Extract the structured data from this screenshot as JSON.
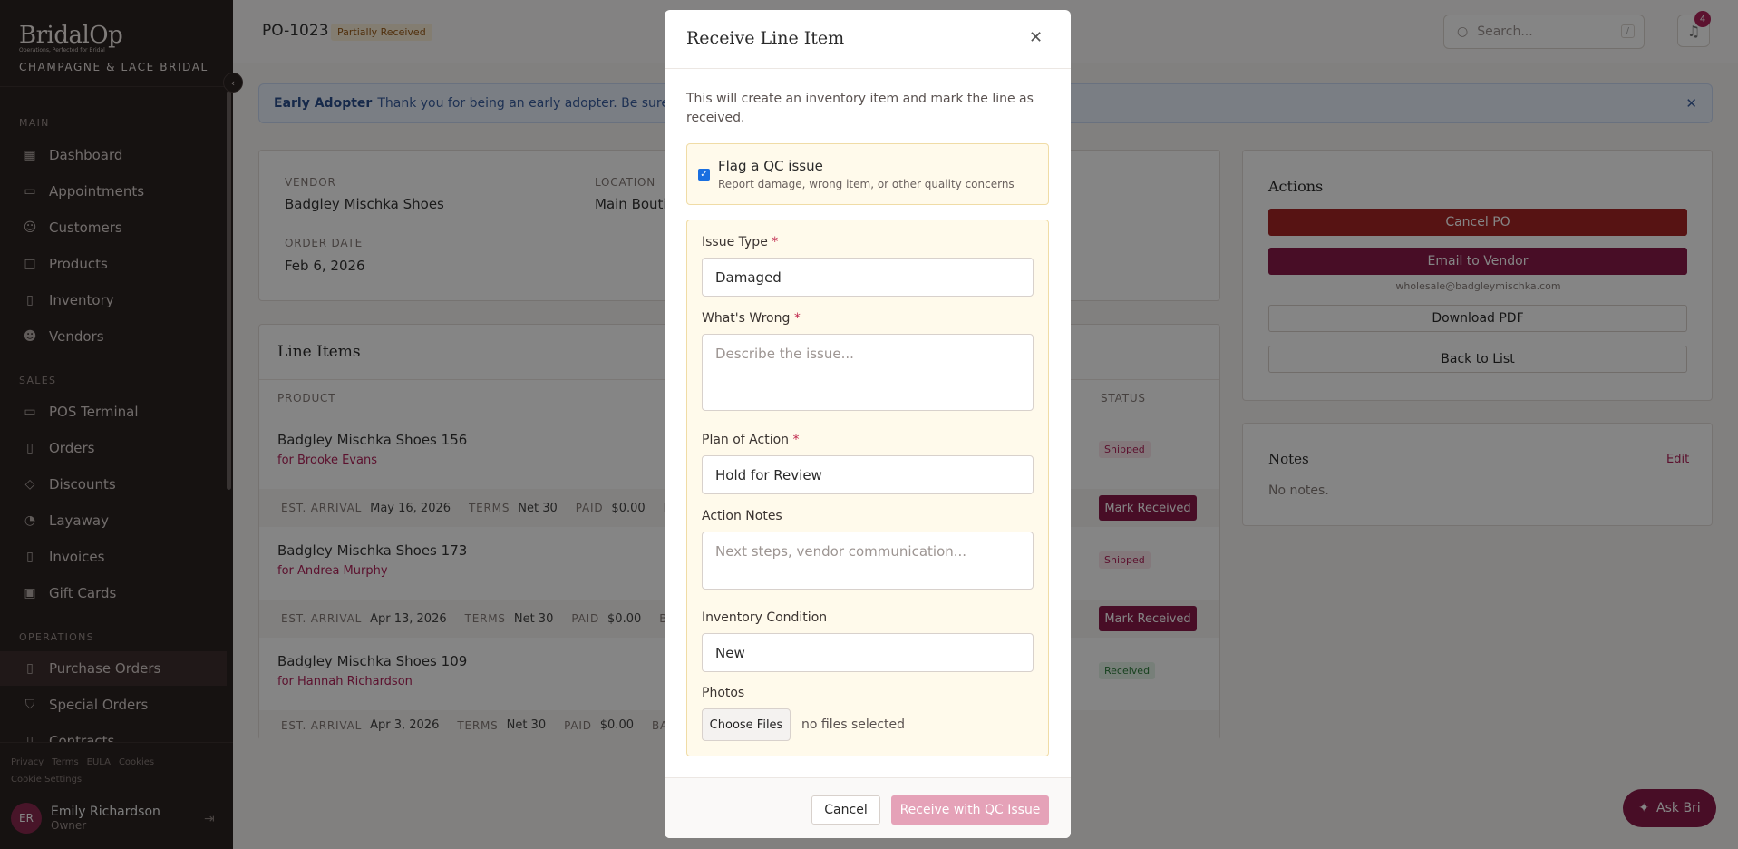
{
  "brand": {
    "logo": "BridalOp",
    "tagline": "Operations, Perfected for Bridal",
    "store": "CHAMPAGNE & LACE BRIDAL"
  },
  "nav": {
    "main_label": "MAIN",
    "sales_label": "SALES",
    "ops_label": "OPERATIONS",
    "main": [
      {
        "label": "Dashboard",
        "icon": "dashboard-icon"
      },
      {
        "label": "Appointments",
        "icon": "calendar-icon"
      },
      {
        "label": "Customers",
        "icon": "user-icon"
      },
      {
        "label": "Products",
        "icon": "box-icon"
      },
      {
        "label": "Inventory",
        "icon": "clipboard-icon"
      },
      {
        "label": "Vendors",
        "icon": "users-icon"
      }
    ],
    "sales": [
      {
        "label": "POS Terminal",
        "icon": "terminal-icon"
      },
      {
        "label": "Orders",
        "icon": "file-icon"
      },
      {
        "label": "Discounts",
        "icon": "tag-icon"
      },
      {
        "label": "Layaway",
        "icon": "clock-icon"
      },
      {
        "label": "Invoices",
        "icon": "file-icon"
      },
      {
        "label": "Gift Cards",
        "icon": "gift-icon"
      }
    ],
    "ops": [
      {
        "label": "Purchase Orders",
        "icon": "clipboard-icon"
      },
      {
        "label": "Special Orders",
        "icon": "shield-icon"
      },
      {
        "label": "Contracts",
        "icon": "file-icon"
      }
    ]
  },
  "legal": {
    "privacy": "Privacy",
    "terms": "Terms",
    "eula": "EULA",
    "cookies": "Cookies",
    "cookie_settings": "Cookie Settings"
  },
  "user": {
    "initials": "ER",
    "name": "Emily Richardson",
    "role": "Owner"
  },
  "header": {
    "po": "PO-1023",
    "status": "Partially Received",
    "search_placeholder": "Search...",
    "search_key": "/",
    "notifications": "4"
  },
  "banner": {
    "title": "Early Adopter",
    "text": "Thank you for being an early adopter. Be sure to contact"
  },
  "details": {
    "vendor_label": "VENDOR",
    "vendor": "Badgley Mischka Shoes",
    "location_label": "LOCATION",
    "location": "Main Boutiq",
    "order_date_label": "ORDER DATE",
    "order_date": "Feb 6, 2026"
  },
  "line_items": {
    "title": "Line Items",
    "col_product": "PRODUCT",
    "col_status": "STATUS",
    "meta_labels": {
      "arrival": "EST. ARRIVAL",
      "terms": "TERMS",
      "paid": "PAID",
      "balance": "BALANC"
    },
    "mark_label": "Mark Received",
    "rows": [
      {
        "name": "Badgley Mischka Shoes 156",
        "for": "for Brooke Evans",
        "arrival": "May 16, 2026",
        "terms": "Net 30",
        "paid": "$0.00",
        "status": "Shipped"
      },
      {
        "name": "Badgley Mischka Shoes 173",
        "for": "for Andrea Murphy",
        "arrival": "Apr 13, 2026",
        "terms": "Net 30",
        "paid": "$0.00",
        "status": "Shipped"
      },
      {
        "name": "Badgley Mischka Shoes 109",
        "for": "for Hannah Richardson",
        "arrival": "Apr 3, 2026",
        "terms": "Net 30",
        "paid": "$0.00",
        "status": "Received"
      }
    ]
  },
  "actions": {
    "title": "Actions",
    "cancel": "Cancel PO",
    "email": "Email to Vendor",
    "email_addr": "wholesale@badgleymischka.com",
    "download": "Download PDF",
    "back": "Back to List"
  },
  "notes": {
    "title": "Notes",
    "edit": "Edit",
    "empty": "No notes."
  },
  "ask": {
    "label": "Ask Bri"
  },
  "modal": {
    "title": "Receive Line Item",
    "desc": "This will create an inventory item and mark the line as received.",
    "qc_title": "Flag a QC issue",
    "qc_sub": "Report damage, wrong item, or other quality concerns",
    "qc_checked": true,
    "issue_type_label": "Issue Type",
    "issue_type": "Damaged",
    "wrong_label": "What's Wrong",
    "wrong_placeholder": "Describe the issue...",
    "plan_label": "Plan of Action",
    "plan": "Hold for Review",
    "notes_label": "Action Notes",
    "notes_placeholder": "Next steps, vendor communication...",
    "condition_label": "Inventory Condition",
    "condition": "New",
    "photos_label": "Photos",
    "choose": "Choose Files",
    "no_files": "no files selected",
    "cancel": "Cancel",
    "submit": "Receive with QC Issue",
    "required": "*"
  },
  "colors": {
    "accent": "#8a1a4a",
    "danger": "#a82626",
    "sidebar": "#2b2322"
  }
}
